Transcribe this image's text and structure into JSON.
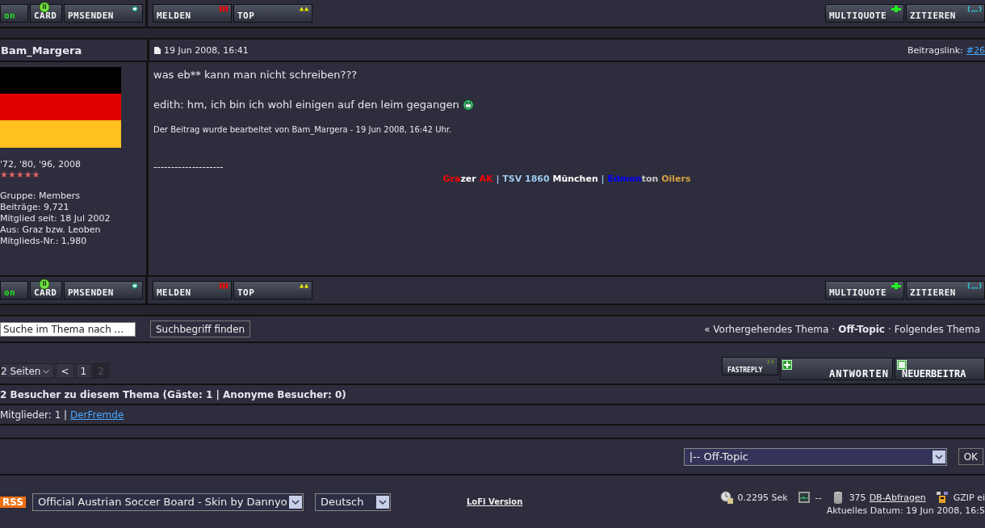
{
  "post_buttons_top": {
    "left": [
      {
        "label": "on",
        "kind": "online"
      },
      {
        "label": "CARD",
        "kind": "card"
      },
      {
        "label": "PMSENDEN",
        "kind": "pm"
      }
    ],
    "middle": [
      {
        "label": "MELDEN",
        "kind": "report"
      },
      {
        "label": "TOP",
        "kind": "top"
      }
    ],
    "right": [
      {
        "label": "MULTIQUOTE",
        "kind": "multiquote"
      },
      {
        "label": "ZITIEREN",
        "kind": "quote"
      }
    ]
  },
  "post": {
    "author": "Bam_Margera",
    "date": "19 Jun 2008, 16:41",
    "link_label": "Beitragslink:",
    "link": "#26",
    "author_info": {
      "title": "'72, '80, '96, 2008",
      "stars": 5,
      "lines": [
        "Gruppe: Members",
        "Beiträge: 9,721",
        "Mitglied seit: 18 Jul 2002",
        "Aus: Graz bzw. Leoben",
        "Mitglieds-Nr.: 1,980"
      ]
    },
    "body": [
      {
        "text": "was eb** kann man nicht schreiben???",
        "emoticon": false
      },
      {
        "text": "edith: hm, ich bin ich wohl einigen auf den leim gegangen",
        "emoticon": true
      }
    ],
    "edit_note": "Der Beitrag wurde bearbeitet von Bam_Margera - 19 Jun 2008, 16:42 Uhr.",
    "signature_rule": "--------------------",
    "signature": [
      {
        "text": "Gra",
        "color": "#ff0000"
      },
      {
        "text": "zer ",
        "color": "#ffffff"
      },
      {
        "text": "AK",
        "color": "#ff0000"
      },
      {
        "text": " | ",
        "color": "#9ec8ee"
      },
      {
        "text": "TSV 1860 ",
        "color": "#9ec8ee"
      },
      {
        "text": "München",
        "color": "#ffffff"
      },
      {
        "text": " | ",
        "color": "#9ec8ee"
      },
      {
        "text": "Edmon",
        "color": "#0000ff"
      },
      {
        "text": "ton ",
        "color": "#c8c8c8"
      },
      {
        "text": "Oilers",
        "color": "#d8a040"
      }
    ]
  },
  "post_buttons_bottom": {
    "left": [
      {
        "label": "on",
        "kind": "online"
      },
      {
        "label": "CARD",
        "kind": "card"
      },
      {
        "label": "PMSENDEN",
        "kind": "pm"
      }
    ],
    "middle": [
      {
        "label": "MELDEN",
        "kind": "report"
      },
      {
        "label": "TOP",
        "kind": "top"
      }
    ],
    "right": [
      {
        "label": "MULTIQUOTE",
        "kind": "multiquote"
      },
      {
        "label": "ZITIEREN",
        "kind": "quote"
      }
    ]
  },
  "search": {
    "value": "Suche im Thema nach ...",
    "button": "Suchbegriff finden"
  },
  "topic_nav": [
    {
      "text": "« Vorhergehendes Thema",
      "kind": "link"
    },
    {
      "text": "·",
      "kind": "sep"
    },
    {
      "text": "Off-Topic",
      "kind": "current"
    },
    {
      "text": "·",
      "kind": "sep"
    },
    {
      "text": "Folgendes Thema",
      "kind": "link"
    }
  ],
  "pagination": {
    "pages_label": "2 Seiten",
    "prev": "<",
    "pages": [
      {
        "label": "1",
        "selected": false
      },
      {
        "label": "2",
        "selected": true
      }
    ]
  },
  "action_buttons": [
    {
      "label": "FASTREPLY",
      "kind": "fastreply"
    },
    {
      "label": "ANTWORTEN",
      "kind": "reply"
    },
    {
      "label": "NEUERBEITRA",
      "kind": "new"
    }
  ],
  "visitors": {
    "title": "2 Besucher zu diesem Thema (Gäste: 1 | Anonyme Besucher: 0)",
    "members_label": "Mitglieder: 1 |",
    "member": "DerFremde"
  },
  "forum_jump": {
    "value": "|-- Off-Topic",
    "button": "OK"
  },
  "footer": {
    "rss": "RSS",
    "skin": "Official Austrian Soccer Board - Skin by Dannyo",
    "language": "Deutsch",
    "lofi": "LoFi Version",
    "stats": [
      {
        "kind": "time",
        "text": "0.2295 Sek"
      },
      {
        "kind": "load",
        "text": "--"
      },
      {
        "kind": "db",
        "text": "375",
        "link": "DB-Abfragen"
      },
      {
        "kind": "gzip",
        "text": "GZIP ei"
      }
    ],
    "date": "Aktuelles Datum: 19 Jun 2008, 16:5"
  }
}
